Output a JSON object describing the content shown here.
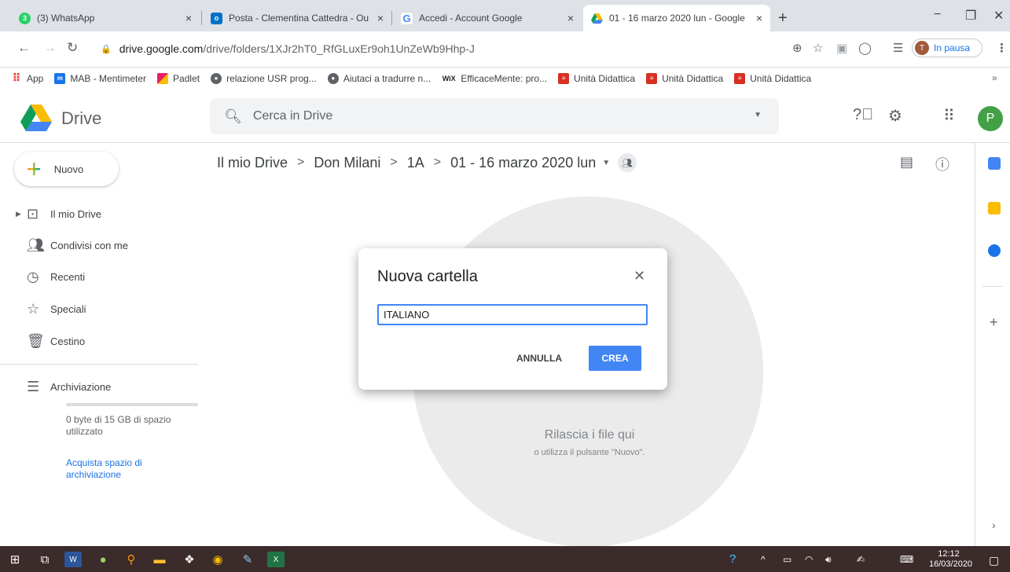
{
  "browser": {
    "tabs": [
      {
        "title": "(3) WhatsApp",
        "close": "×"
      },
      {
        "title": "Posta - Clementina Cattedra - Ou",
        "close": "×"
      },
      {
        "title": "Accedi - Account Google",
        "close": "×"
      },
      {
        "title": "01 - 16 marzo 2020 lun - Google",
        "close": "×"
      }
    ],
    "new_tab": "+",
    "window_controls": {
      "minimize": "−",
      "restore": "❐",
      "close": "✕"
    },
    "url_host": "drive.google.com",
    "url_path": "/drive/folders/1XJr2hT0_RfGLuxEr9oh1UnZeWb9Hhp-J",
    "profile_initial": "T",
    "profile_status": "In pausa",
    "bookmarks": [
      {
        "label": "App",
        "color": "#ea4335"
      },
      {
        "label": "MAB - Mentimeter",
        "color": "#1a73e8"
      },
      {
        "label": "Padlet",
        "color": "#e6a000"
      },
      {
        "label": "relazione USR prog...",
        "color": "#5f6368"
      },
      {
        "label": "Aiutaci a tradurre n...",
        "color": "#5f6368"
      },
      {
        "label": "EfficaceMente: pro...",
        "color": "#202124"
      },
      {
        "label": "Unità Didattica",
        "color": "#d93025"
      },
      {
        "label": "Unità Didattica",
        "color": "#d93025"
      },
      {
        "label": "Unità Didattica",
        "color": "#d93025"
      }
    ],
    "bookmarks_more": "»"
  },
  "drive": {
    "brand": "Drive",
    "search_placeholder": "Cerca in Drive",
    "user_initial": "P",
    "new_button": "Nuovo",
    "sidebar": [
      {
        "label": "Il mio Drive",
        "icon": "drive-icon"
      },
      {
        "label": "Condivisi con me",
        "icon": "people-icon"
      },
      {
        "label": "Recenti",
        "icon": "clock-icon"
      },
      {
        "label": "Speciali",
        "icon": "star-icon"
      },
      {
        "label": "Cestino",
        "icon": "trash-icon"
      }
    ],
    "storage_label": "Archiviazione",
    "storage_text": "0 byte di 15 GB di spazio utilizzato",
    "storage_fraction": 0,
    "buy_storage": "Acquista spazio di archiviazione",
    "breadcrumb": [
      "Il mio Drive",
      "Don Milani",
      "1A",
      "01 - 16 marzo 2020 lun"
    ],
    "breadcrumb_sep": ">",
    "drop_title": "Rilascia i file qui",
    "drop_subtitle": "o utilizza il pulsante \"Nuovo\"."
  },
  "dialog": {
    "title": "Nuova cartella",
    "input_value": "ITALIANO",
    "cancel": "ANNULLA",
    "create": "CREA"
  },
  "taskbar": {
    "time": "12:12",
    "date": "16/03/2020"
  },
  "colors": {
    "accent": "#4285f4",
    "taskbar": "#3b2b2a"
  }
}
